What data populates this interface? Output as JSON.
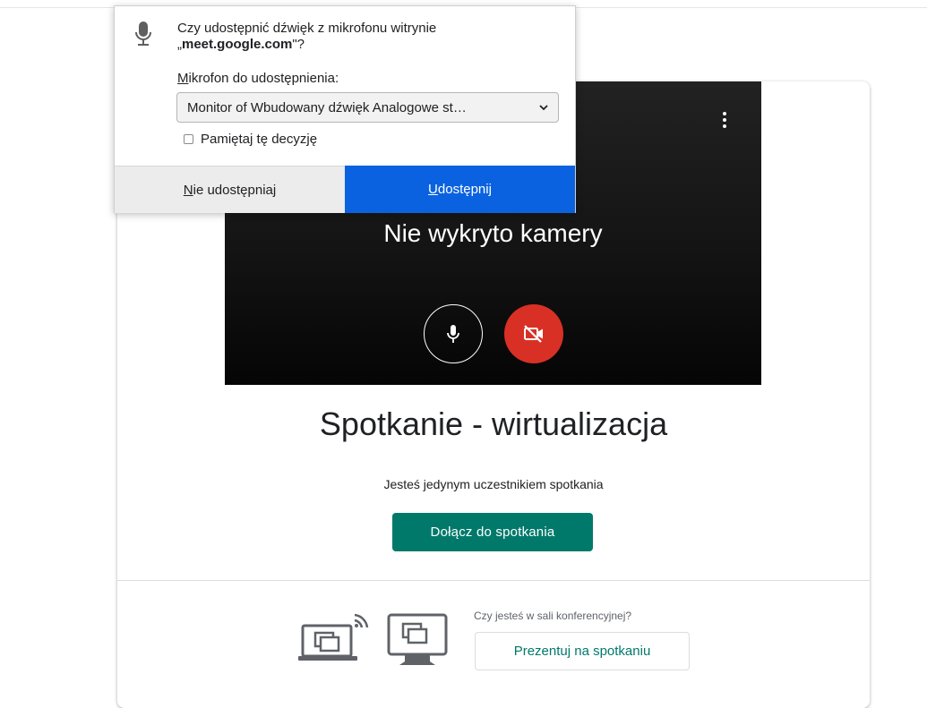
{
  "popup": {
    "question_prefix": "Czy udostępnić dźwięk z mikrofonu witrynie",
    "question_open_quote": "„",
    "question_site": "meet.google.com",
    "question_close": "\"?",
    "mic_label_first": "M",
    "mic_label_rest": "ikrofon do udostępnienia:",
    "mic_selected": "Monitor of Wbudowany dźwięk Analogowe st…",
    "remember_label": "Pamiętaj tę decyzję",
    "deny_first": "N",
    "deny_rest": "ie udostępniaj",
    "allow_first": "U",
    "allow_rest": "dostępnij",
    "allow_color": "#0a62e0"
  },
  "preview": {
    "no_camera_text": "Nie wykryto kamery",
    "camera_off_color": "#d93025"
  },
  "meeting": {
    "title": "Spotkanie - wirtualizacja",
    "status": "Jesteś jedynym uczestnikiem spotkania",
    "join_label": "Dołącz do spotkania",
    "room_question": "Czy jesteś w sali konferencyjnej?",
    "present_label": "Prezentuj na spotkaniu",
    "accent_color": "#00796b"
  }
}
